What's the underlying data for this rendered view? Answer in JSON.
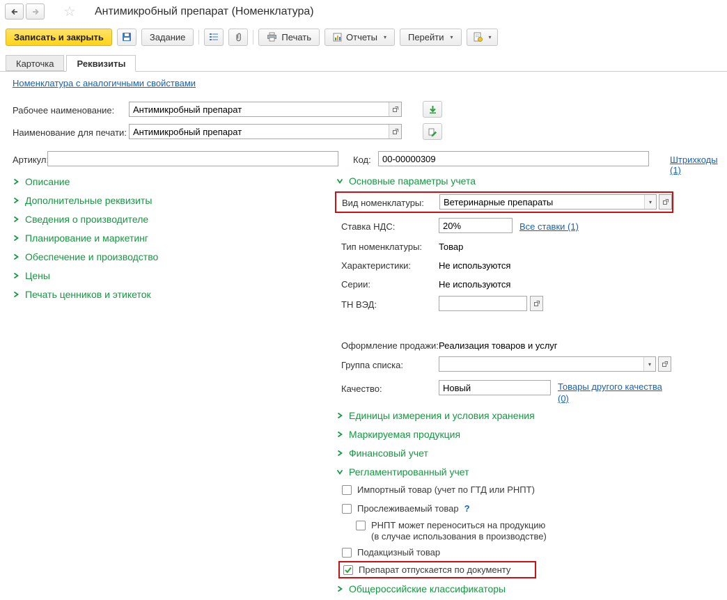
{
  "icons": {
    "star": "☆",
    "dropdown": "▾"
  },
  "colors": {
    "accent_green": "#12993f",
    "link_blue": "#1661bc",
    "highlight_red": "#cf1010",
    "primary_button_yellow": "#ffd415"
  },
  "header": {
    "title": "Антимикробный препарат (Номенклатура)"
  },
  "toolbar": {
    "save_close": "Записать и закрыть",
    "task": "Задание",
    "print": "Печать",
    "reports": "Отчеты",
    "goto": "Перейти"
  },
  "tabs": {
    "card": "Карточка",
    "requisites": "Реквизиты"
  },
  "top": {
    "similar_link": "Номенклатура с аналогичными свойствами",
    "working_name_label": "Рабочее наименование:",
    "working_name_value": "Антимикробный препарат",
    "print_name_label": "Наименование для печати:",
    "print_name_value": "Антимикробный препарат",
    "article_label": "Артикул:",
    "code_label": "Код:",
    "code_value": "00-00000309",
    "barcodes_link": "Штрихкоды (1)"
  },
  "left_sections": {
    "s0": "Описание",
    "s1": "Дополнительные реквизиты",
    "s2": "Сведения о производителе",
    "s3": "Планирование и маркетинг",
    "s4": "Обеспечение и производство",
    "s5": "Цены",
    "s6": "Печать ценников и этикеток"
  },
  "main_params": {
    "title": "Основные параметры учета",
    "kind_label": "Вид номенклатуры:",
    "kind_value": "Ветеринарные препараты",
    "vat_label": "Ставка НДС:",
    "vat_value": "20%",
    "all_rates_link": "Все ставки (1)",
    "type_label": "Тип номенклатуры:",
    "type_value": "Товар",
    "chars_label": "Характеристики:",
    "chars_value": "Не используются",
    "series_label": "Серии:",
    "series_value": "Не используются",
    "tnved_label": "ТН ВЭД:",
    "sale_label": "Оформление продажи:",
    "sale_value": "Реализация товаров и услуг",
    "group_label": "Группа списка:",
    "quality_label": "Качество:",
    "quality_value": "Новый",
    "other_quality_link": "Товары другого качества (0)"
  },
  "right_sections": {
    "units": "Единицы измерения и условия хранения",
    "marked": "Маркируемая продукция",
    "fin": "Финансовый учет",
    "reg": "Регламентированный учет",
    "classifiers": "Общероссийские классификаторы"
  },
  "reg": {
    "import": "Импортный товар (учет по ГТД или РНПТ)",
    "traceable": "Прослеживаемый товар",
    "traceable_help": "?",
    "rnpt_line1": "РНПТ может переноситься на продукцию",
    "rnpt_line2": "(в случае использования в производстве)",
    "excise": "Подакцизный товар",
    "dispensed": "Препарат отпускается по документу"
  }
}
